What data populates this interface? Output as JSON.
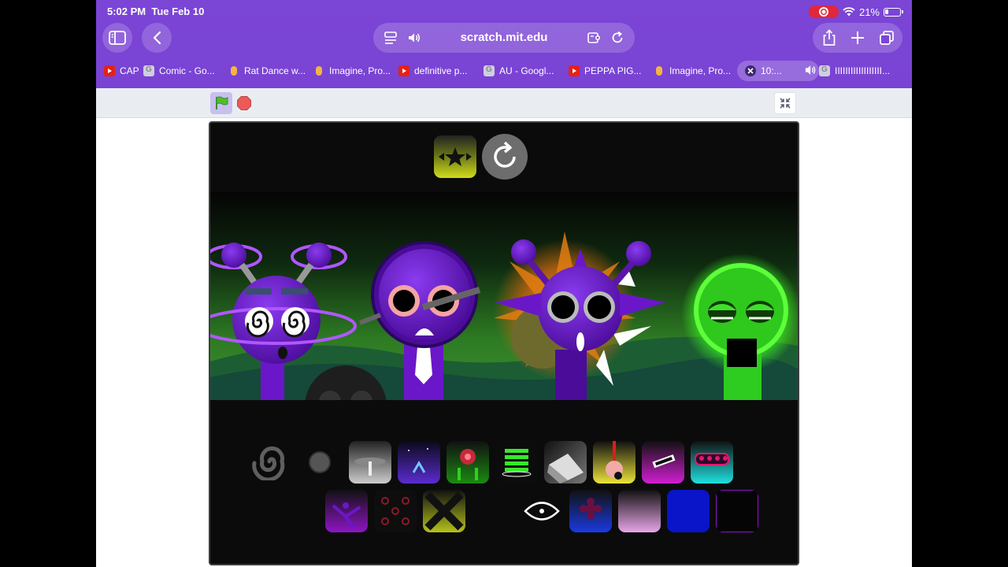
{
  "status_bar": {
    "time": "5:02 PM",
    "date": "Tue Feb 10",
    "battery": "21%"
  },
  "browser": {
    "url": "scratch.mit.edu",
    "tabs": [
      {
        "label": "CAP",
        "favicon": "youtube-icon"
      },
      {
        "label": "Comic - Go...",
        "favicon": "google-icon"
      },
      {
        "label": "Rat Dance w...",
        "favicon": "scratch-icon"
      },
      {
        "label": "Imagine, Pro...",
        "favicon": "scratch-icon"
      },
      {
        "label": "definitive p...",
        "favicon": "youtube-icon"
      },
      {
        "label": "AU - Googl...",
        "favicon": "google-icon"
      },
      {
        "label": "PEPPA PIG...",
        "favicon": "youtube-icon"
      },
      {
        "label": "Imagine, Pro...",
        "favicon": "scratch-icon"
      },
      {
        "label": "10:...",
        "favicon": "close-icon",
        "active": true
      },
      {
        "label": "IIIIIIIIIIIIIIIIII...",
        "favicon": "google-icon"
      }
    ]
  },
  "colors": {
    "chrome_purple": "#7b45d6",
    "scene_green": "#1f6a28",
    "character_purple": "#6a17c9",
    "glow_green": "#5cff3a",
    "stage_bg": "#0b0b0b"
  },
  "stage": {
    "characters": [
      "spiral-eyed-character",
      "tie-character",
      "spiky-character",
      "green-glowing-character",
      "shadow-character"
    ],
    "sound_tiles_row1": [
      "cymbal-tile",
      "lightning-tile",
      "flower-tile",
      "green-stripes-tile",
      "fan-tile",
      "pendulum-tile",
      "purple-card-tile",
      "cyan-crowd-tile"
    ],
    "sound_tiles_row2": [
      "star-burst-tile",
      "red-dots-tile",
      "yellow-x-tile",
      "eye-tile",
      "blue-flower-tile",
      "pink-gradient-tile",
      "blue-square-tile",
      "dark-square-tile"
    ]
  }
}
